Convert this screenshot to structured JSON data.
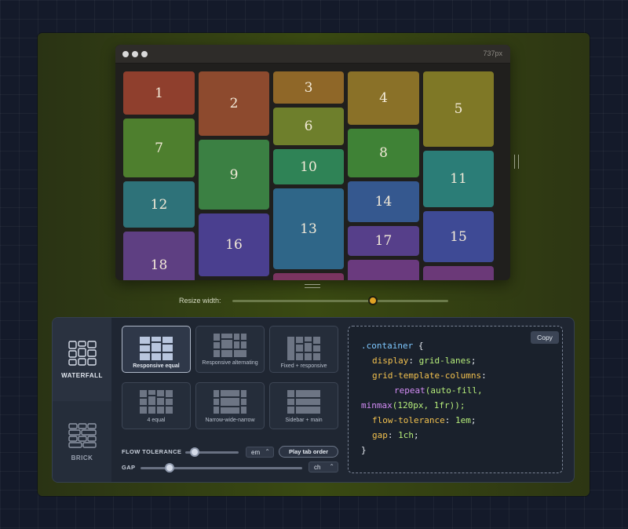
{
  "preview": {
    "width_readout": "737px",
    "tiles": [
      {
        "label": "1",
        "color": "#8f3f2d"
      },
      {
        "label": "2",
        "color": "#8d4a2e"
      },
      {
        "label": "3",
        "color": "#8f6728"
      },
      {
        "label": "4",
        "color": "#8a7128"
      },
      {
        "label": "5",
        "color": "#7f7826"
      },
      {
        "label": "6",
        "color": "#6e7f2c"
      },
      {
        "label": "7",
        "color": "#4e7f2e"
      },
      {
        "label": "8",
        "color": "#3f8236"
      },
      {
        "label": "9",
        "color": "#3b8043"
      },
      {
        "label": "10",
        "color": "#2f8356"
      },
      {
        "label": "11",
        "color": "#2b7d77"
      },
      {
        "label": "12",
        "color": "#2e7279"
      },
      {
        "label": "13",
        "color": "#2f6688"
      },
      {
        "label": "14",
        "color": "#35588f"
      },
      {
        "label": "15",
        "color": "#3e4a95"
      },
      {
        "label": "16",
        "color": "#4a3f8f"
      },
      {
        "label": "17",
        "color": "#563f8a"
      },
      {
        "label": "18",
        "color": "#5e3f82"
      },
      {
        "label": "",
        "color": "#7a3460"
      },
      {
        "label": "",
        "color": "#6a3a7e"
      },
      {
        "label": "",
        "color": "#6b3978"
      }
    ]
  },
  "resize": {
    "label": "Resize width:",
    "value_fraction": 0.65
  },
  "layout_tabs": [
    {
      "label": "WATERFALL",
      "icon": "waterfall-grid-icon",
      "active": true
    },
    {
      "label": "BRICK",
      "icon": "brick-grid-icon",
      "active": false
    }
  ],
  "presets": [
    {
      "label": "Responsive equal",
      "icon": "responsive-equal-icon",
      "active": true
    },
    {
      "label": "Responsive alternating",
      "icon": "responsive-alternating-icon",
      "active": false
    },
    {
      "label": "Fixed + responsive",
      "icon": "fixed-responsive-icon",
      "active": false
    },
    {
      "label": "4 equal",
      "icon": "four-equal-icon",
      "active": false
    },
    {
      "label": "Narrow-wide-narrow",
      "icon": "narrow-wide-narrow-icon",
      "active": false
    },
    {
      "label": "Sidebar + main",
      "icon": "sidebar-main-icon",
      "active": false
    }
  ],
  "controls": {
    "flow_tolerance_label": "FLOW TOLERANCE",
    "flow_tolerance_fraction": 0.18,
    "flow_unit": "em",
    "play_label": "Play tab order",
    "gap_label": "GAP",
    "gap_fraction": 0.18,
    "gap_unit": "ch"
  },
  "code": {
    "copy_label": "Copy",
    "selector": ".container",
    "open_brace": " {",
    "display_prop": "display",
    "display_val": "grid-lanes",
    "columns_prop": "grid-template-columns",
    "repeat_fn": "repeat",
    "repeat_arg": "(auto-fill,",
    "minmax_fn": "minmax",
    "minmax_arg": "(120px, 1fr));",
    "tolerance_prop": "flow-tolerance",
    "tolerance_val": "1em",
    "gap_prop": "gap",
    "gap_val": "1ch",
    "close_brace": "}"
  },
  "colors": {
    "accent_thumb": "#e0a324",
    "code_selector": "#7ec8ff",
    "code_property": "#f2c14e",
    "code_value": "#b5ec7a",
    "code_function": "#d38cf5"
  }
}
